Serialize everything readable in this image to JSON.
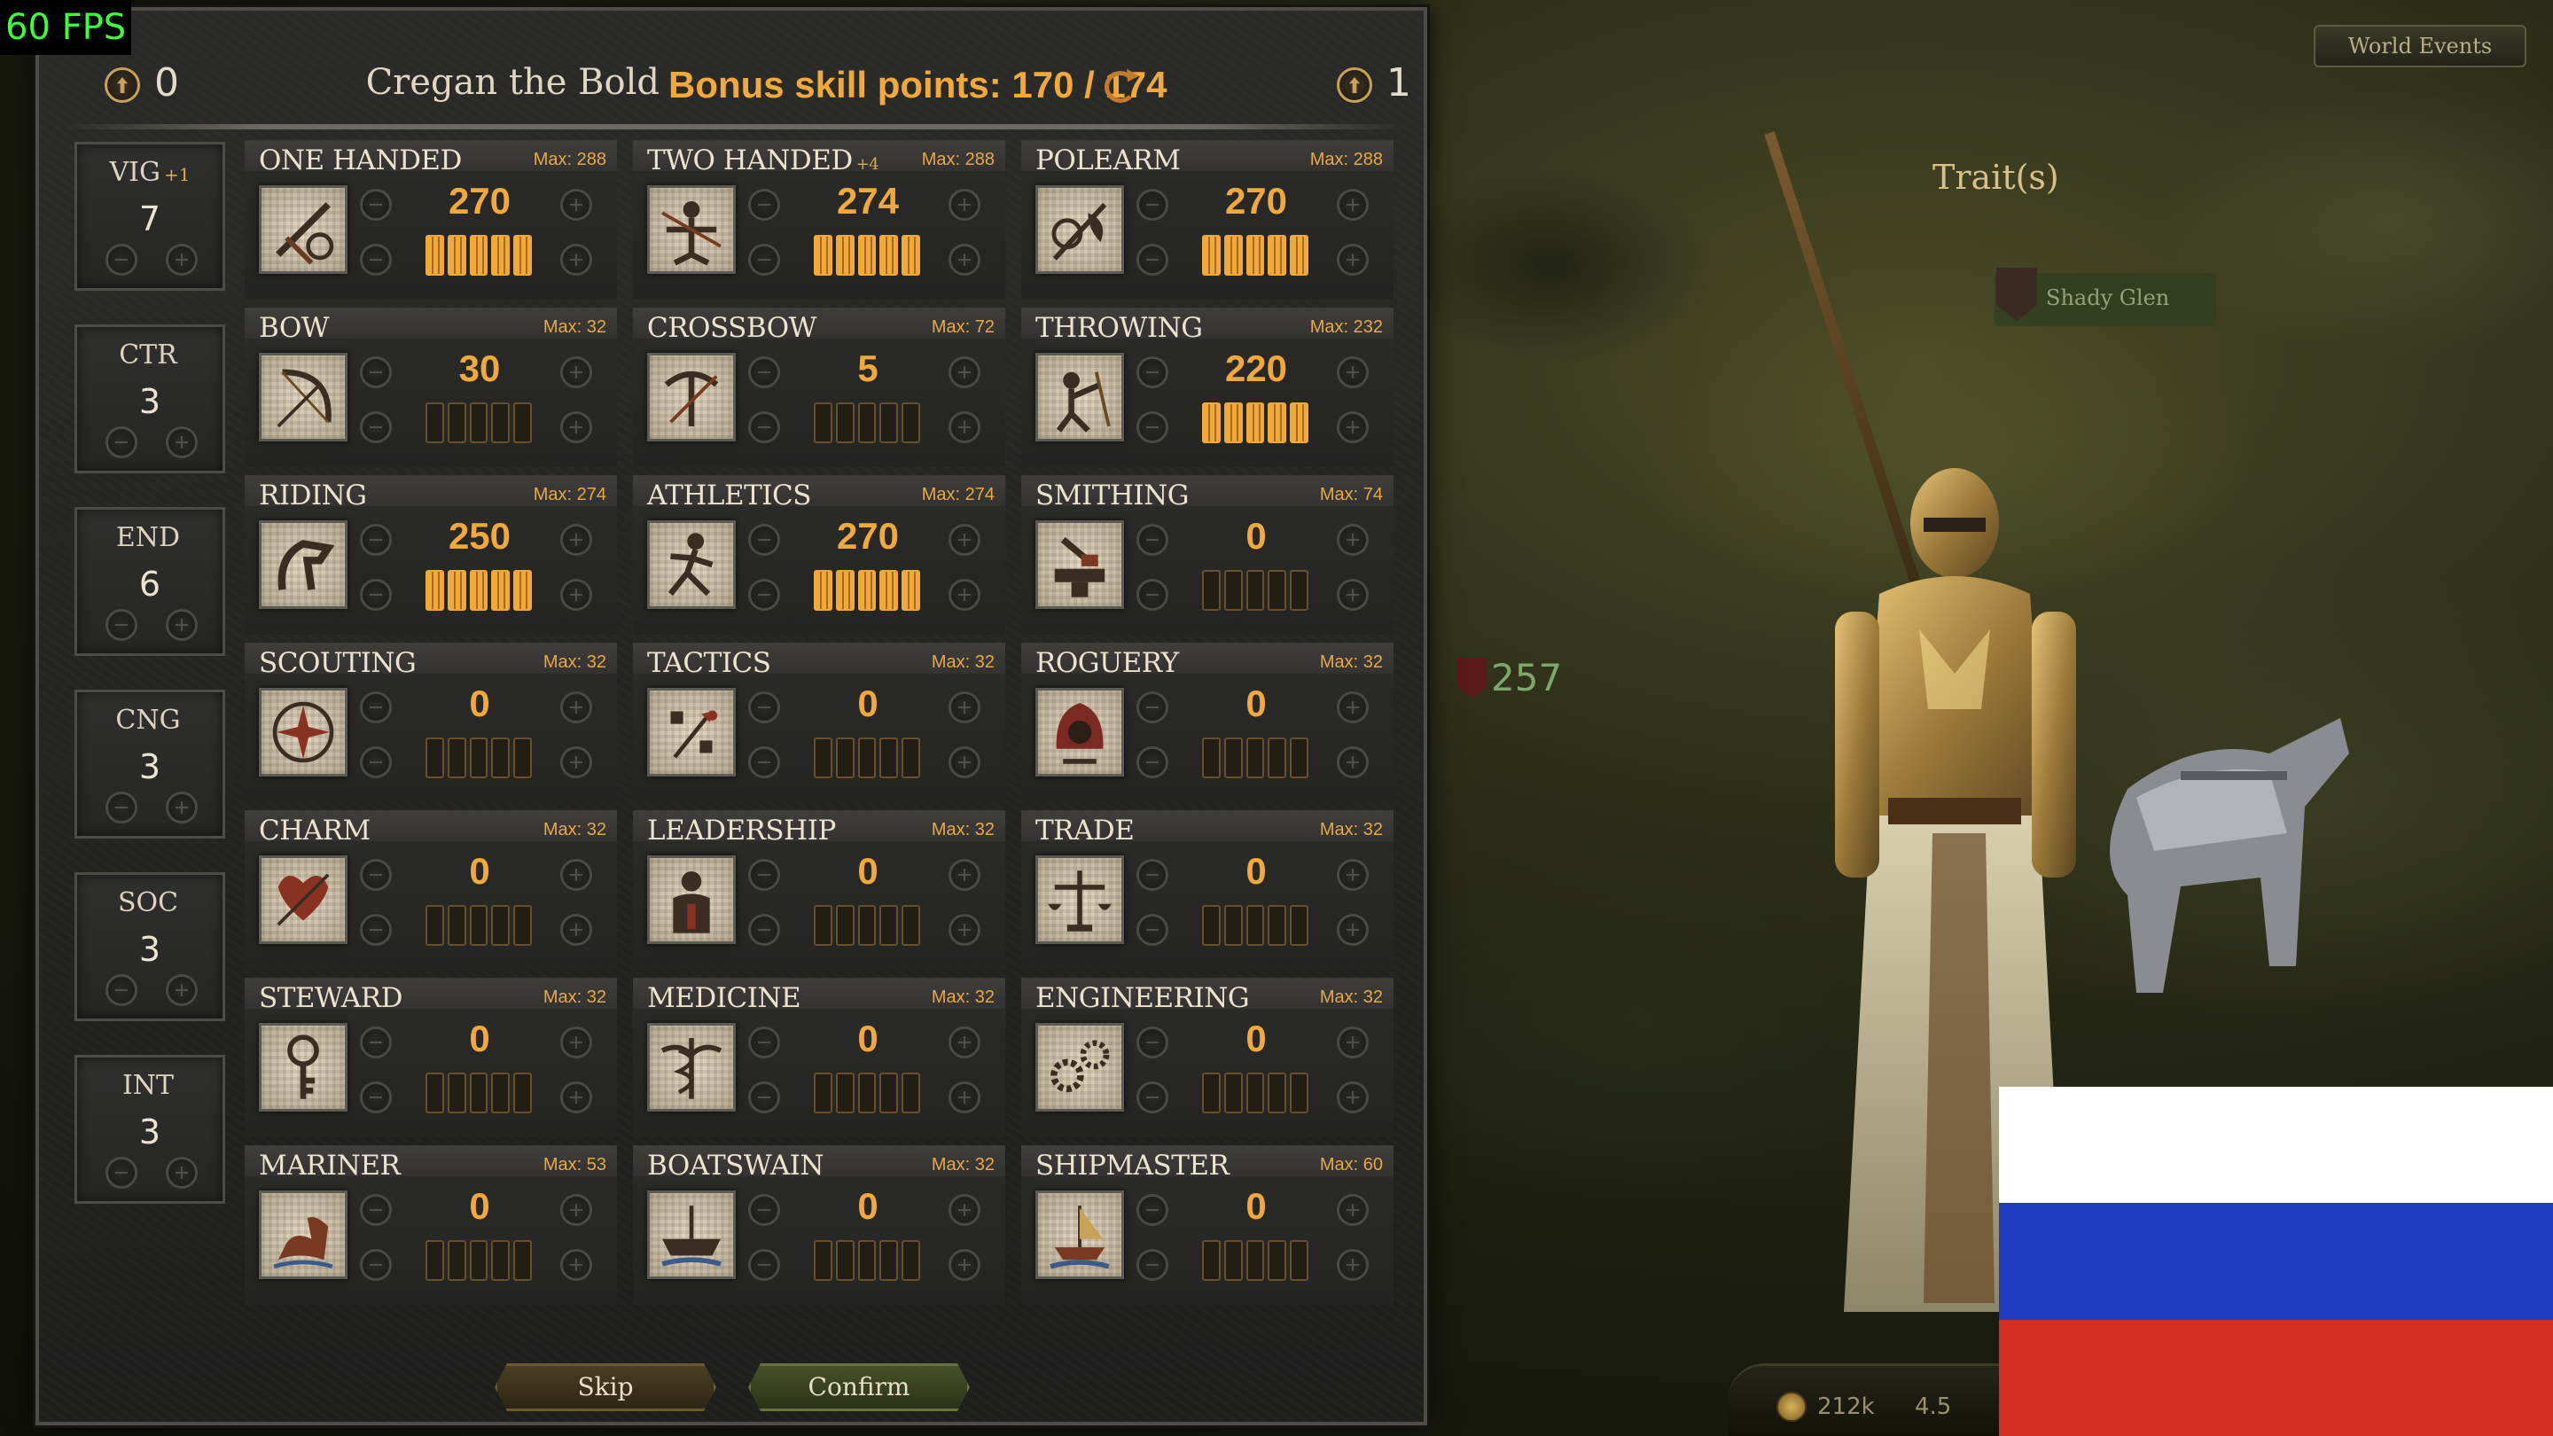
{
  "hud": {
    "fps": "60 FPS",
    "world_events": "World Events",
    "traits_label": "Trait(s)",
    "settlement_name": "Shady Glen",
    "party_size": "257",
    "gold": "212k",
    "influence": "4.5"
  },
  "header": {
    "attribute_points": "0",
    "hero_name": "Cregan the Bold",
    "bonus_skill_points": "Bonus skill points: 170 / 174",
    "focus_points": "1"
  },
  "attributes": [
    {
      "name": "VIG",
      "bonus": "+1",
      "value": "7"
    },
    {
      "name": "CTR",
      "bonus": "",
      "value": "3"
    },
    {
      "name": "END",
      "bonus": "",
      "value": "6"
    },
    {
      "name": "CNG",
      "bonus": "",
      "value": "3"
    },
    {
      "name": "SOC",
      "bonus": "",
      "value": "3"
    },
    {
      "name": "INT",
      "bonus": "",
      "value": "3"
    }
  ],
  "skills": [
    {
      "name": "ONE HANDED",
      "bonus": "",
      "max": "Max: 288",
      "value": "270",
      "focus": 5,
      "icon": "one-handed-icon"
    },
    {
      "name": "TWO HANDED",
      "bonus": "+4",
      "max": "Max: 288",
      "value": "274",
      "focus": 5,
      "icon": "two-handed-icon"
    },
    {
      "name": "POLEARM",
      "bonus": "",
      "max": "Max: 288",
      "value": "270",
      "focus": 5,
      "icon": "polearm-icon"
    },
    {
      "name": "BOW",
      "bonus": "",
      "max": "Max: 32",
      "value": "30",
      "focus": 0,
      "icon": "bow-icon"
    },
    {
      "name": "CROSSBOW",
      "bonus": "",
      "max": "Max: 72",
      "value": "5",
      "focus": 0,
      "icon": "crossbow-icon"
    },
    {
      "name": "THROWING",
      "bonus": "",
      "max": "Max: 232",
      "value": "220",
      "focus": 5,
      "icon": "throwing-icon"
    },
    {
      "name": "RIDING",
      "bonus": "",
      "max": "Max: 274",
      "value": "250",
      "focus": 5,
      "icon": "riding-icon"
    },
    {
      "name": "ATHLETICS",
      "bonus": "",
      "max": "Max: 274",
      "value": "270",
      "focus": 5,
      "icon": "athletics-icon"
    },
    {
      "name": "SMITHING",
      "bonus": "",
      "max": "Max: 74",
      "value": "0",
      "focus": 0,
      "icon": "smithing-icon"
    },
    {
      "name": "SCOUTING",
      "bonus": "",
      "max": "Max: 32",
      "value": "0",
      "focus": 0,
      "icon": "scouting-icon"
    },
    {
      "name": "TACTICS",
      "bonus": "",
      "max": "Max: 32",
      "value": "0",
      "focus": 0,
      "icon": "tactics-icon"
    },
    {
      "name": "ROGUERY",
      "bonus": "",
      "max": "Max: 32",
      "value": "0",
      "focus": 0,
      "icon": "roguery-icon"
    },
    {
      "name": "CHARM",
      "bonus": "",
      "max": "Max: 32",
      "value": "0",
      "focus": 0,
      "icon": "charm-icon"
    },
    {
      "name": "LEADERSHIP",
      "bonus": "",
      "max": "Max: 32",
      "value": "0",
      "focus": 0,
      "icon": "leadership-icon"
    },
    {
      "name": "TRADE",
      "bonus": "",
      "max": "Max: 32",
      "value": "0",
      "focus": 0,
      "icon": "trade-icon"
    },
    {
      "name": "STEWARD",
      "bonus": "",
      "max": "Max: 32",
      "value": "0",
      "focus": 0,
      "icon": "steward-icon"
    },
    {
      "name": "MEDICINE",
      "bonus": "",
      "max": "Max: 32",
      "value": "0",
      "focus": 0,
      "icon": "medicine-icon"
    },
    {
      "name": "ENGINEERING",
      "bonus": "",
      "max": "Max: 32",
      "value": "0",
      "focus": 0,
      "icon": "engineering-icon"
    },
    {
      "name": "MARINER",
      "bonus": "",
      "max": "Max: 53",
      "value": "0",
      "focus": 0,
      "icon": "mariner-icon"
    },
    {
      "name": "BOATSWAIN",
      "bonus": "",
      "max": "Max: 32",
      "value": "0",
      "focus": 0,
      "icon": "boatswain-icon"
    },
    {
      "name": "SHIPMASTER",
      "bonus": "",
      "max": "Max: 60",
      "value": "0",
      "focus": 0,
      "icon": "shipmaster-icon"
    }
  ],
  "buttons": {
    "skip": "Skip",
    "confirm": "Confirm"
  },
  "colors": {
    "accent_orange": "#f0a93a",
    "flag_white": "#ffffff",
    "flag_blue": "#1c3bc0",
    "flag_red": "#d42e22"
  }
}
